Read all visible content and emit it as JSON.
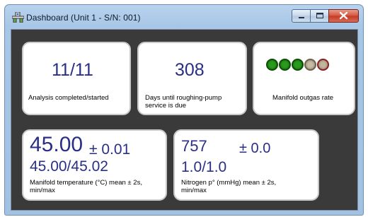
{
  "window": {
    "title": "Dashboard (Unit 1 - S/N: 001)",
    "icons": [
      "dashboard-app-icon",
      "minimize-icon",
      "maximize-icon",
      "close-icon"
    ]
  },
  "cards": {
    "analysis": {
      "value": "11/11",
      "label": "Analysis completed/started"
    },
    "pump": {
      "value": "308",
      "label_line1": "Days until roughing-pump",
      "label_line2": "service is due"
    },
    "outgas": {
      "label": "Manifold outgas rate",
      "indicators": [
        {
          "color": "#1a7a0f",
          "state": "green"
        },
        {
          "color": "#1a7a0f",
          "state": "green"
        },
        {
          "color": "#1a7a0f",
          "state": "green"
        },
        {
          "color": "#b6a58a",
          "state": "grey"
        },
        {
          "color": "#b6a58a",
          "state": "grey-red"
        }
      ]
    },
    "temperature": {
      "mean": "45.00",
      "sd": "± 0.01",
      "minmax": "45.00/45.02",
      "label_line1": "Manifold temperature (°C) mean ± 2s,",
      "label_line2": "min/max"
    },
    "nitrogen": {
      "mean": "757",
      "sd": "± 0.0",
      "minmax": "1.0/1.0",
      "label_line1": "Nitrogen p° (mmHg) mean ± 2s,",
      "label_line2": "min/max"
    }
  },
  "colors": {
    "value_text": "#2a2f86",
    "panel_background": "#3a3a3a",
    "titlebar": "#b9d3ee"
  }
}
